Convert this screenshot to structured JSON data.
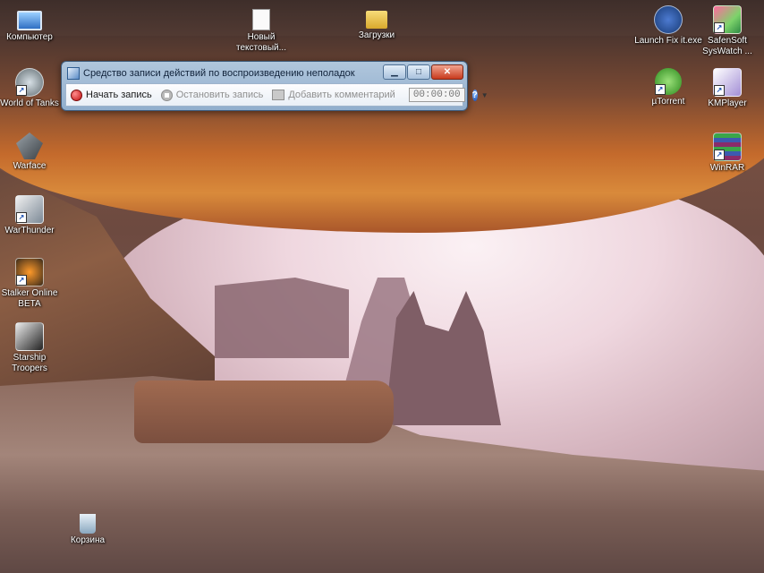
{
  "desktop": {
    "icons": {
      "computer": {
        "label": "Компьютер",
        "icon": "computer-icon"
      },
      "new_text_doc": {
        "label": "Новый текстовый...",
        "icon": "text-document-icon"
      },
      "downloads": {
        "label": "Загрузки",
        "icon": "folder-icon"
      },
      "world_of_tanks": {
        "label": "World of Tanks",
        "icon": "world-of-tanks-icon"
      },
      "warface": {
        "label": "Warface",
        "icon": "warface-icon"
      },
      "warthunder": {
        "label": "WarThunder",
        "icon": "warthunder-icon"
      },
      "stalker": {
        "label": "Stalker Online BETA",
        "icon": "stalker-icon"
      },
      "starship": {
        "label": "Starship Troopers",
        "icon": "starship-troopers-icon"
      },
      "recycle_bin": {
        "label": "Корзина",
        "icon": "recycle-bin-icon"
      },
      "launch_fixit": {
        "label": "Launch Fix it.exe",
        "icon": "fix-it-icon"
      },
      "safensoft": {
        "label": "SafenSoft SysWatch ...",
        "icon": "safensoft-icon"
      },
      "utorrent": {
        "label": "µTorrent",
        "icon": "utorrent-icon"
      },
      "kmplayer": {
        "label": "KMPlayer",
        "icon": "kmplayer-icon"
      },
      "winrar": {
        "label": "WinRAR",
        "icon": "winrar-icon"
      }
    }
  },
  "psr": {
    "title": "Средство записи действий по воспроизведению неполадок",
    "start_label": "Начать запись",
    "stop_label": "Остановить запись",
    "comment_label": "Добавить комментарий",
    "timer": "00:00:00",
    "help_glyph": "?",
    "dropdown_glyph": "▼",
    "minimize_glyph": "▁",
    "maximize_glyph": "□",
    "close_glyph": "✕"
  }
}
